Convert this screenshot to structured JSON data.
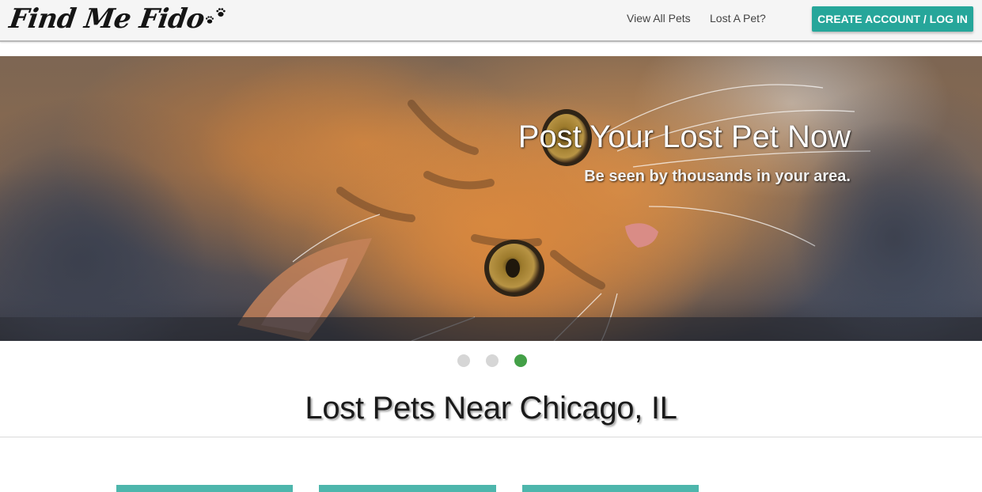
{
  "navbar": {
    "brand": "Find Me Fido",
    "links": [
      {
        "label": "View All Pets"
      },
      {
        "label": "Lost A Pet?"
      }
    ],
    "cta_label": "Create Account / Log In"
  },
  "carousel": {
    "title": "Post Your Lost Pet Now",
    "subtitle": "Be seen by thousands in your area.",
    "slide_count": 3,
    "active_index": 2,
    "image": "cat-photo"
  },
  "section": {
    "title": "Lost Pets Near Chicago, IL"
  },
  "colors": {
    "primary": "#26a69a",
    "active_indicator": "#43a047",
    "card_header": "#4db6ac"
  }
}
